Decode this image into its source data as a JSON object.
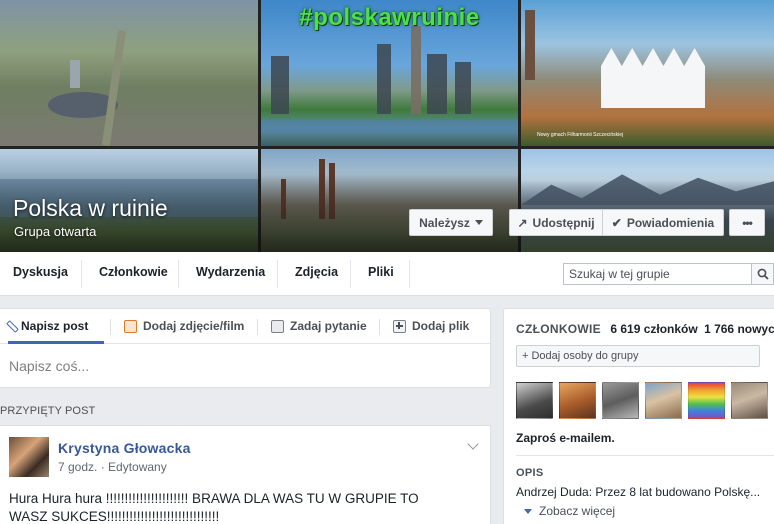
{
  "cover": {
    "hashtag": "#polskawruinie",
    "photo_caption": "Nowy gmach Filharmonii Szczecińskiej",
    "group_name": "Polska w ruinie",
    "group_type": "Grupa otwarta",
    "buttons": {
      "member": "Należysz",
      "share": "Udostępnij",
      "notifications": "Powiadomienia",
      "more": "•••"
    }
  },
  "tabs": [
    "Dyskusja",
    "Członkowie",
    "Wydarzenia",
    "Zdjęcia",
    "Pliki"
  ],
  "search": {
    "placeholder": "Szukaj w tej grupie"
  },
  "composer": {
    "tabs": [
      "Napisz post",
      "Dodaj zdjęcie/film",
      "Zadaj pytanie",
      "Dodaj plik"
    ],
    "placeholder": "Napisz coś..."
  },
  "pinned": {
    "label": "PRZYPIĘTY POST",
    "author": "Krystyna Głowacka",
    "meta": "7 godz. · Edytowany",
    "text": "Hura Hura hura !!!!!!!!!!!!!!!!!!!!!! BRAWA DLA WAS TU W GRUPIE TO WASZ SUKCES!!!!!!!!!!!!!!!!!!!!!!!!!!!!!!"
  },
  "members": {
    "label": "CZŁONKOWIE",
    "count": "6 619 członków",
    "new_count": "1 766",
    "new_label": "nowych",
    "add_button": "+ Dodaj osoby do grupy",
    "invite": "Zaproś e-mailem."
  },
  "description": {
    "label": "OPIS",
    "text": "Andrzej Duda: Przez 8 lat budowano Polskę...",
    "see_more": "Zobacz więcej"
  },
  "colors": {
    "hashtag": "#4de04a",
    "link": "#365899",
    "accent": "#4267b2",
    "background": "#e9ebee"
  }
}
